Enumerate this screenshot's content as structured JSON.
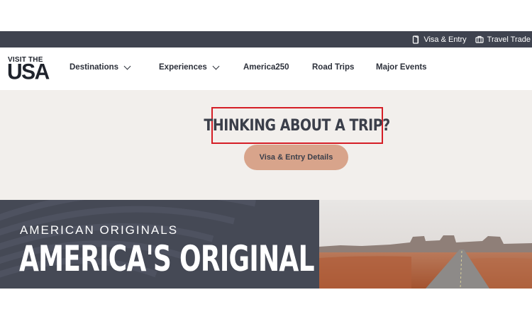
{
  "utility_bar": {
    "visa_label": "Visa & Entry",
    "trade_label": "Travel Trade"
  },
  "logo": {
    "small": "VISIT THE",
    "big": "USA"
  },
  "nav": {
    "items": [
      {
        "label": "Destinations",
        "has_dropdown": true
      },
      {
        "label": "Experiences",
        "has_dropdown": true
      },
      {
        "label": "America250",
        "has_dropdown": false
      },
      {
        "label": "Road Trips",
        "has_dropdown": false
      },
      {
        "label": "Major Events",
        "has_dropdown": false
      }
    ]
  },
  "hero": {
    "title": "THINKING ABOUT A TRIP?",
    "button_label": "Visa & Entry Details"
  },
  "banner": {
    "kicker": "AMERICAN ORIGINALS",
    "title": "AMERICA'S ORIGINAL"
  },
  "colors": {
    "utility_bar": "#3f434f",
    "hero_bg": "#f2efec",
    "button": "#d8a48b",
    "highlight_box": "#d51e26",
    "banner_bg": "#454955"
  }
}
